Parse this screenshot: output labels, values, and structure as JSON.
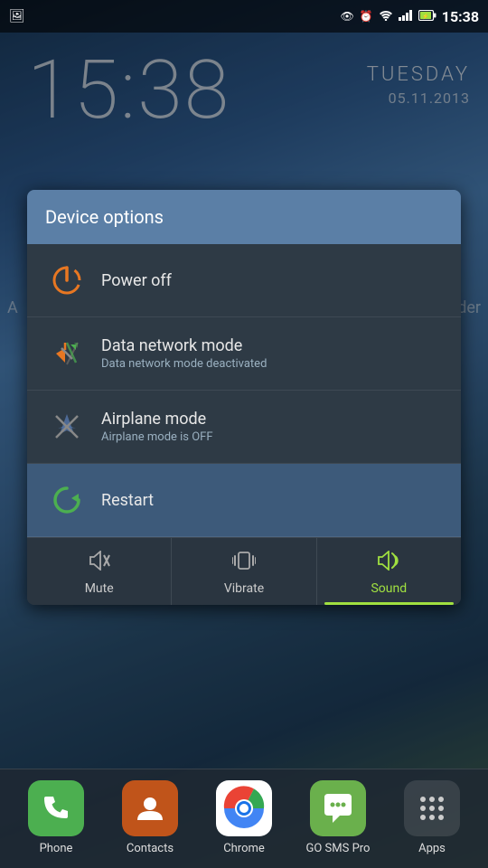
{
  "statusBar": {
    "time": "15:38",
    "icons": [
      "photo",
      "eye",
      "alarm",
      "wifi",
      "signal",
      "battery"
    ]
  },
  "wallpaper": {
    "time": "15:38",
    "day": "TUESDAY",
    "date": "05.11.2013"
  },
  "modal": {
    "title": "Device options",
    "items": [
      {
        "id": "power-off",
        "label": "Power off",
        "sublabel": "",
        "icon": "power"
      },
      {
        "id": "data-network",
        "label": "Data network mode",
        "sublabel": "Data network mode deactivated",
        "icon": "data"
      },
      {
        "id": "airplane-mode",
        "label": "Airplane mode",
        "sublabel": "Airplane mode is OFF",
        "icon": "airplane"
      },
      {
        "id": "restart",
        "label": "Restart",
        "sublabel": "",
        "icon": "restart"
      }
    ],
    "soundButtons": [
      {
        "id": "mute",
        "label": "Mute",
        "active": false
      },
      {
        "id": "vibrate",
        "label": "Vibrate",
        "active": false
      },
      {
        "id": "sound",
        "label": "Sound",
        "active": true
      }
    ]
  },
  "dock": {
    "items": [
      {
        "id": "phone",
        "label": "Phone"
      },
      {
        "id": "contacts",
        "label": "Contacts"
      },
      {
        "id": "chrome",
        "label": "Chrome"
      },
      {
        "id": "gosms",
        "label": "GO SMS Pro"
      },
      {
        "id": "apps",
        "label": "Apps"
      }
    ]
  }
}
